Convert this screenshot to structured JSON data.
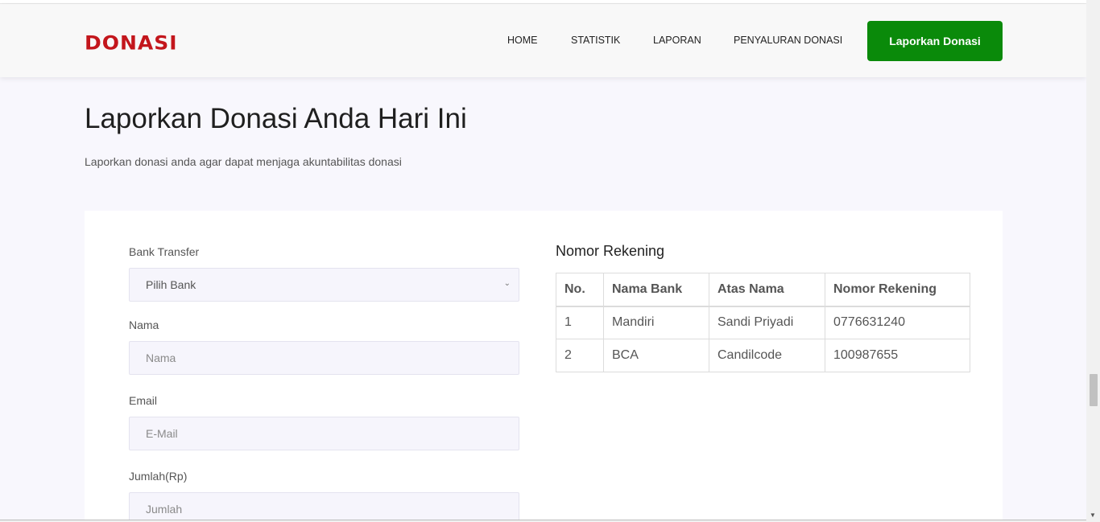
{
  "header": {
    "logo": "DONASI",
    "nav": [
      {
        "label": "HOME"
      },
      {
        "label": "STATISTIK"
      },
      {
        "label": "LAPORAN"
      },
      {
        "label": "PENYALURAN DONASI"
      }
    ],
    "cta_label": "Laporkan Donasi"
  },
  "hero": {
    "title": "Laporkan Donasi Anda Hari Ini",
    "subtitle": "Laporkan donasi anda agar dapat menjaga akuntabilitas donasi"
  },
  "form": {
    "bank_label": "Bank Transfer",
    "bank_selected": "Pilih Bank",
    "name_label": "Nama",
    "name_placeholder": "Nama",
    "email_label": "Email",
    "email_placeholder": "E-Mail",
    "amount_label": "Jumlah(Rp)",
    "amount_placeholder": "Jumlah"
  },
  "rekening": {
    "title": "Nomor Rekening",
    "columns": [
      "No.",
      "Nama Bank",
      "Atas Nama",
      "Nomor Rekening"
    ],
    "rows": [
      [
        "1",
        "Mandiri",
        "Sandi Priyadi",
        "0776631240"
      ],
      [
        "2",
        "BCA",
        "Candilcode",
        "100987655"
      ]
    ]
  },
  "icons": {
    "select_chevron": "chevron-down-icon",
    "scroll_down": "arrow-down-icon"
  },
  "colors": {
    "brand": "#c3161c",
    "cta": "#0a8a0a"
  }
}
